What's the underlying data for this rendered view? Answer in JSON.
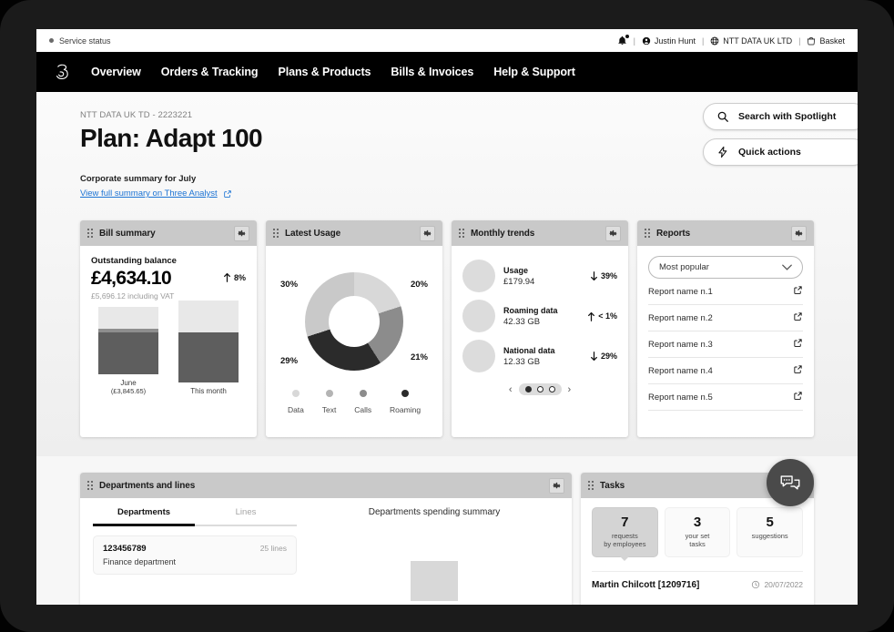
{
  "utility_bar": {
    "service_status": "Service status",
    "notifications_icon": "bell-icon",
    "user": "Justin Hunt",
    "organisation": "NTT DATA UK LTD",
    "basket": "Basket",
    "separator": "|"
  },
  "nav": {
    "logo": "three-logo",
    "links": [
      {
        "label": "Overview"
      },
      {
        "label": "Orders & Tracking"
      },
      {
        "label": "Plans & Products"
      },
      {
        "label": "Bills & Invoices"
      },
      {
        "label": "Help & Support"
      }
    ]
  },
  "header": {
    "account": "NTT DATA UK TD - 2223221",
    "title": "Plan: Adapt 100",
    "corporate_summary": "Corporate summary for July",
    "view_link": "View full summary on Three Analyst",
    "link_color": "#1c74d4",
    "buttons": [
      {
        "label": "Search with Spotlight",
        "icon": "search-icon"
      },
      {
        "label": "Quick actions",
        "icon": "lightning-icon"
      }
    ]
  },
  "cards": {
    "bill_summary": {
      "title": "Bill summary",
      "balance_label": "Outstanding balance",
      "balance": "£4,634.10",
      "including_vat": "£5,696.12 including VAT",
      "trend": "8%",
      "trend_direction": "up",
      "bars": [
        {
          "label": "June",
          "sub": "(£3,845.65)"
        },
        {
          "label": "This month",
          "sub": ""
        }
      ]
    },
    "latest_usage": {
      "title": "Latest Usage",
      "labels": {
        "tr": "20%",
        "br": "21%",
        "bl": "29%",
        "tl": "30%"
      },
      "legend": [
        {
          "label": "Data",
          "color": "#d8d8d8"
        },
        {
          "label": "Text",
          "color": "#b4b4b4"
        },
        {
          "label": "Calls",
          "color": "#8c8c8c"
        },
        {
          "label": "Roaming",
          "color": "#2b2b2b"
        }
      ]
    },
    "monthly_trends": {
      "title": "Monthly trends",
      "rows": [
        {
          "name": "Usage",
          "value": "£179.94",
          "delta": "39%",
          "direction": "down"
        },
        {
          "name": "Roaming data",
          "value": "42.33 GB",
          "delta": "< 1%",
          "direction": "up"
        },
        {
          "name": "National data",
          "value": "12.33 GB",
          "delta": "29%",
          "direction": "down"
        }
      ],
      "pager": {
        "prev": "‹",
        "next": "›",
        "pages": 3,
        "active": 1
      }
    },
    "reports": {
      "title": "Reports",
      "filter_value": "Most popular",
      "items": [
        {
          "label": "Report name n.1",
          "icon": "external-link-icon"
        },
        {
          "label": "Report name n.2",
          "icon": "external-link-icon"
        },
        {
          "label": "Report name n.3",
          "icon": "external-link-icon"
        },
        {
          "label": "Report name n.4",
          "icon": "external-link-icon"
        },
        {
          "label": "Report name n.5",
          "icon": "external-link-icon"
        }
      ]
    },
    "departments": {
      "title": "Departments and lines",
      "tabs": [
        {
          "label": "Departments",
          "active": true
        },
        {
          "label": "Lines",
          "active": false
        }
      ],
      "chart_title": "Departments spending summary",
      "rows": [
        {
          "number": "123456789",
          "lines": "25 lines",
          "name": "Finance department"
        }
      ]
    },
    "tasks": {
      "title": "Tasks",
      "tiles": [
        {
          "count": "7",
          "label": "requests\nby employees",
          "selected": true
        },
        {
          "count": "3",
          "label": "your set\ntasks",
          "selected": false
        },
        {
          "count": "5",
          "label": "suggestions",
          "selected": false
        }
      ],
      "row": {
        "name": "Martin Chilcott [1209716]",
        "date": "20/07/2022",
        "icon": "clock-icon"
      }
    }
  },
  "fab": {
    "icon": "chat-bubbles-icon"
  },
  "chart_data": [
    {
      "type": "pie",
      "title": "Latest Usage",
      "categories": [
        "Text",
        "Calls",
        "Roaming",
        "Data"
      ],
      "values": [
        20,
        21,
        29,
        30
      ],
      "labels": [
        "20%",
        "21%",
        "29%",
        "30%"
      ],
      "colors": [
        "#d8d8d8",
        "#8c8c8c",
        "#2b2b2b",
        "#c4c4c4"
      ],
      "legend": [
        "Data",
        "Text",
        "Calls",
        "Roaming"
      ],
      "legend_position": "bottom"
    },
    {
      "type": "bar",
      "title": "Bill summary",
      "categories": [
        "June",
        "This month"
      ],
      "values": [
        3845.65,
        4634.1
      ],
      "ylabel": "",
      "xlabel": "",
      "grid": false
    },
    {
      "type": "bar",
      "title": "Departments spending summary",
      "categories": [
        ""
      ],
      "values": [
        1
      ],
      "grid": false
    }
  ]
}
